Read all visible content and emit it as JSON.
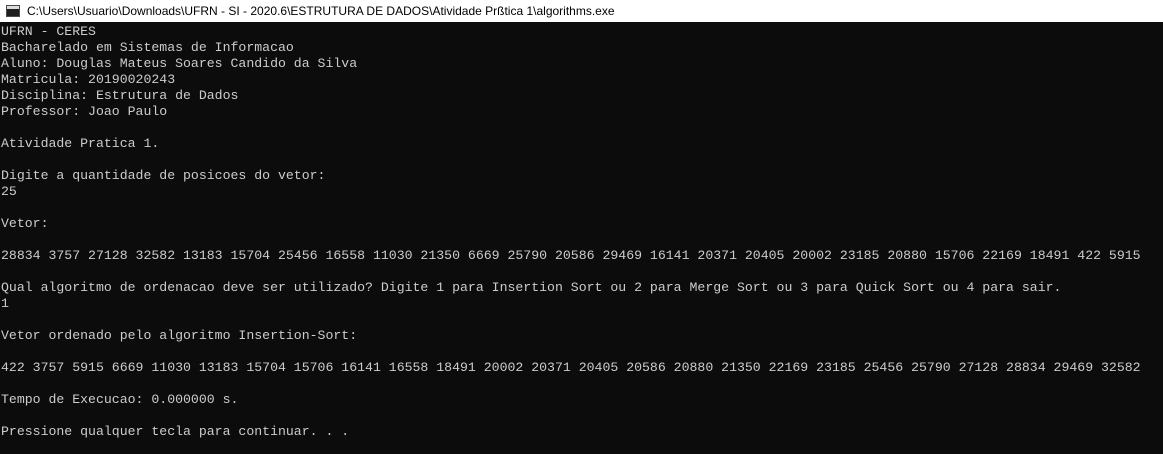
{
  "window": {
    "title": "C:\\Users\\Usuario\\Downloads\\UFRN - SI - 2020.6\\ESTRUTURA DE DADOS\\Atividade Prßtica 1\\algorithms.exe",
    "icon": "console-app-icon",
    "background_color": "#0c0c0c",
    "text_color": "#cccccc"
  },
  "console": {
    "lines": [
      "UFRN - CERES",
      "Bacharelado em Sistemas de Informacao",
      "Aluno: Douglas Mateus Soares Candido da Silva",
      "Matricula: 20190020243",
      "Disciplina: Estrutura de Dados",
      "Professor: Joao Paulo",
      "",
      "Atividade Pratica 1.",
      "",
      "Digite a quantidade de posicoes do vetor:",
      "25",
      "",
      "Vetor:",
      "",
      "28834 3757 27128 32582 13183 15704 25456 16558 11030 21350 6669 25790 20586 29469 16141 20371 20405 20002 23185 20880 15706 22169 18491 422 5915",
      "",
      "Qual algoritmo de ordenacao deve ser utilizado? Digite 1 para Insertion Sort ou 2 para Merge Sort ou 3 para Quick Sort ou 4 para sair.",
      "1",
      "",
      "Vetor ordenado pelo algoritmo Insertion-Sort:",
      "",
      "422 3757 5915 6669 11030 13183 15704 15706 16141 16558 18491 20002 20371 20405 20586 20880 21350 22169 23185 25456 25790 27128 28834 29469 32582",
      "",
      "Tempo de Execucao: 0.000000 s.",
      "",
      "Pressione qualquer tecla para continuar. . ."
    ]
  }
}
